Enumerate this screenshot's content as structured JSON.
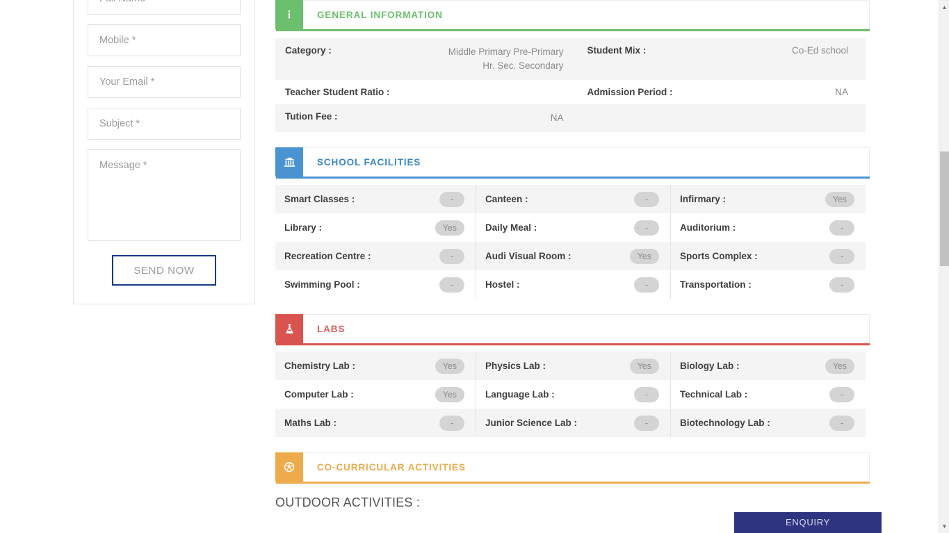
{
  "contact_form": {
    "fields": [
      {
        "name": "full-name",
        "placeholder": "Full Name *"
      },
      {
        "name": "mobile",
        "placeholder": "Mobile *"
      },
      {
        "name": "email",
        "placeholder": "Your Email *"
      },
      {
        "name": "subject",
        "placeholder": "Subject *"
      }
    ],
    "message_placeholder": "Message *",
    "submit_label": "SEND NOW"
  },
  "general_information": {
    "title": "GENERAL INFORMATION",
    "icon": "info-icon",
    "accent_color": "#6cbf6c",
    "rows": [
      {
        "label": "Category :",
        "value": "Middle  Primary  Pre-Primary Hr. Sec.  Secondary",
        "label2": "Student Mix :",
        "value2": "Co-Ed school"
      },
      {
        "label": "Teacher Student Ratio :",
        "value": "",
        "label2": "Admission Period :",
        "value2": "NA"
      },
      {
        "label": "Tution Fee :",
        "value": "NA",
        "label2": "",
        "value2": ""
      }
    ],
    "category_line1": "Middle     Primary     Pre-Primary",
    "category_line2": "Hr. Sec.    Secondary"
  },
  "school_facilities": {
    "title": "SCHOOL FACILITIES",
    "icon": "bank-icon",
    "accent_color": "#4a93d1",
    "rows": [
      [
        {
          "label": "Smart Classes :",
          "value": "-"
        },
        {
          "label": "Canteen :",
          "value": "-"
        },
        {
          "label": "Infirmary :",
          "value": "Yes"
        }
      ],
      [
        {
          "label": "Library :",
          "value": "Yes"
        },
        {
          "label": "Daily Meal :",
          "value": "-"
        },
        {
          "label": "Auditorium :",
          "value": "-"
        }
      ],
      [
        {
          "label": "Recreation Centre :",
          "value": "-"
        },
        {
          "label": "Audi Visual Room :",
          "value": "Yes"
        },
        {
          "label": "Sports Complex :",
          "value": "-"
        }
      ],
      [
        {
          "label": "Swimming Pool :",
          "value": "-"
        },
        {
          "label": "Hostel :",
          "value": "-"
        },
        {
          "label": "Transportation :",
          "value": "-"
        }
      ]
    ]
  },
  "labs": {
    "title": "LABS",
    "icon": "flask-icon",
    "accent_color": "#d9534f",
    "rows": [
      [
        {
          "label": "Chemistry Lab :",
          "value": "Yes"
        },
        {
          "label": "Physics Lab :",
          "value": "Yes"
        },
        {
          "label": "Biology Lab :",
          "value": "Yes"
        }
      ],
      [
        {
          "label": "Computer Lab :",
          "value": "Yes"
        },
        {
          "label": "Language Lab :",
          "value": "-"
        },
        {
          "label": "Technical Lab :",
          "value": "-"
        }
      ],
      [
        {
          "label": "Maths Lab :",
          "value": "-"
        },
        {
          "label": "Junior Science Lab :",
          "value": "-"
        },
        {
          "label": "Biotechnology Lab :",
          "value": "-"
        }
      ]
    ]
  },
  "co_curricular": {
    "title": "CO-CURRICULAR ACTIVITIES",
    "icon": "soccer-ball-icon",
    "accent_color": "#eeab4c",
    "outdoor_label": "OUTDOOR ACTIVITIES :"
  },
  "enquiry": {
    "label": "ENQUIRY",
    "color": "#2f3480"
  }
}
